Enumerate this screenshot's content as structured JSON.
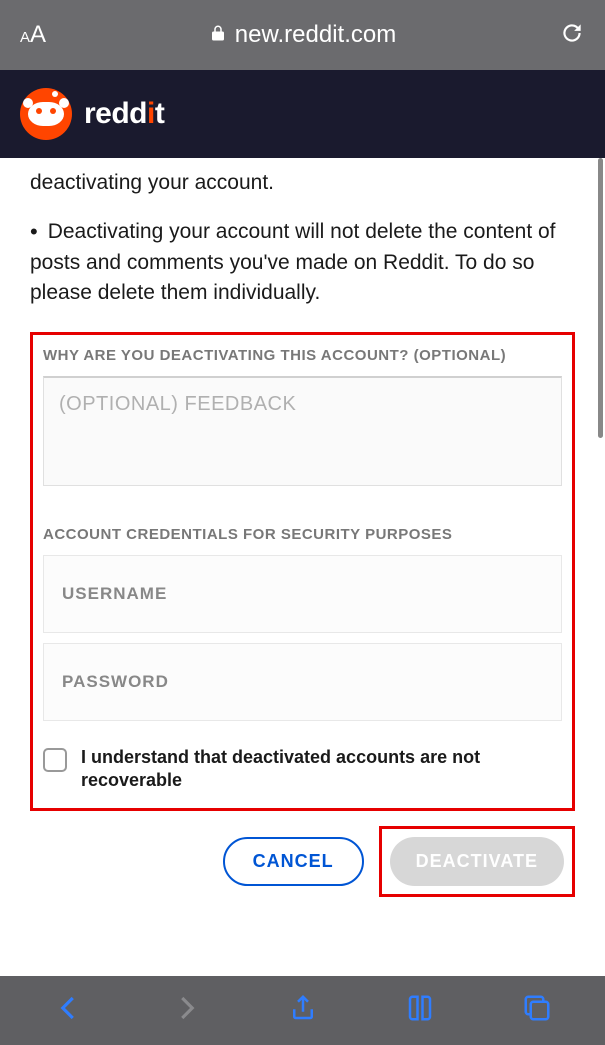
{
  "browser": {
    "url": "new.reddit.com"
  },
  "header": {
    "brand": "reddit"
  },
  "content": {
    "truncated_text": "deactivating your account.",
    "bullet_text": "Deactivating your account will not delete the content of posts and comments you've made on Reddit. To do so please delete them individually.",
    "reason_label": "WHY ARE YOU DEACTIVATING THIS ACCOUNT? (OPTIONAL)",
    "feedback_placeholder": "(OPTIONAL) FEEDBACK",
    "credentials_label": "ACCOUNT CREDENTIALS FOR SECURITY PURPOSES",
    "username_placeholder": "USERNAME",
    "password_placeholder": "PASSWORD",
    "checkbox_label": "I understand that deactivated accounts are not recoverable",
    "cancel_label": "CANCEL",
    "deactivate_label": "DEACTIVATE"
  }
}
